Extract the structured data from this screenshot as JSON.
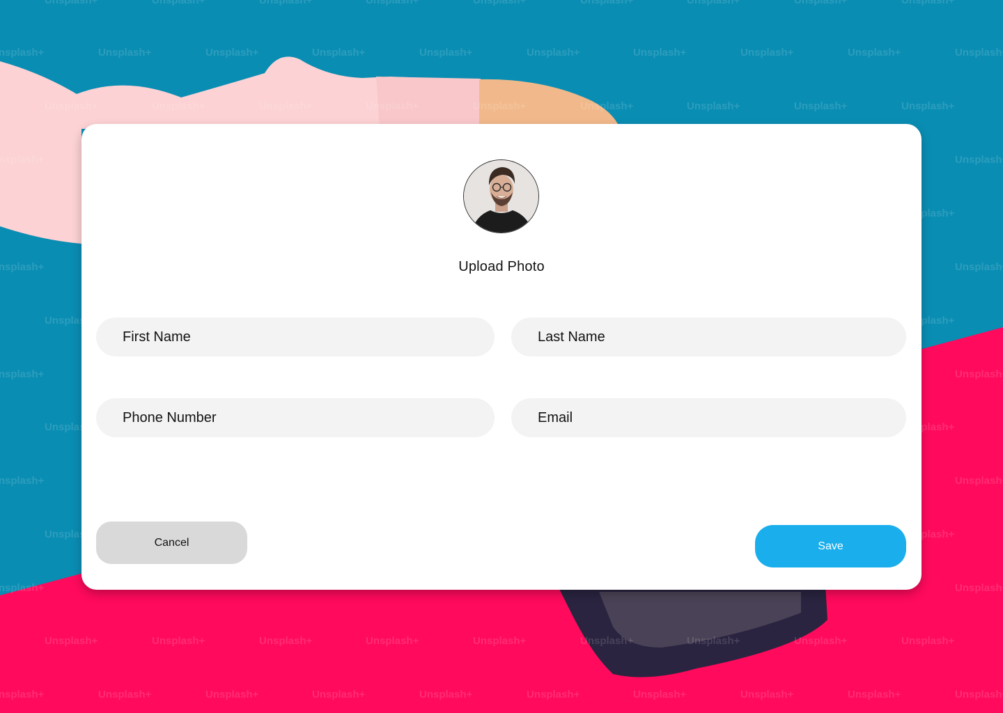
{
  "watermark_text": "Unsplash+",
  "form": {
    "upload_label": "Upload Photo",
    "first_name_placeholder": "First Name",
    "last_name_placeholder": "Last Name",
    "phone_placeholder": "Phone Number",
    "email_placeholder": "Email",
    "cancel_label": "Cancel",
    "save_label": "Save"
  },
  "colors": {
    "background_blue": "#0a8db3",
    "background_pink": "#ff0a5c",
    "save_button": "#1aaeec",
    "cancel_button": "#d9d9d9",
    "field_background": "#f3f3f3"
  }
}
